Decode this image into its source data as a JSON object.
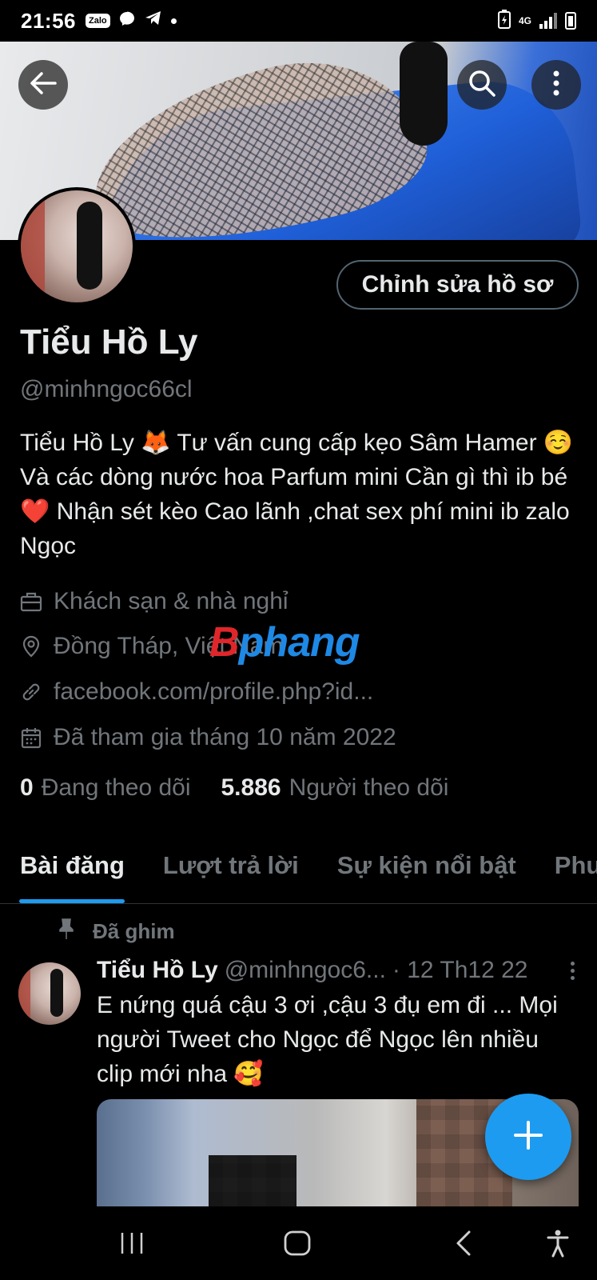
{
  "status_bar": {
    "time": "21:56",
    "zalo_badge": "Zalo",
    "network": "4G",
    "icons": [
      "zalo-icon",
      "messenger-icon",
      "telegram-icon",
      "notification-dot",
      "battery-saver-icon",
      "network-4g-icon",
      "signal-icon",
      "battery-icon"
    ]
  },
  "header": {
    "back_icon": "arrow-left-icon",
    "search_icon": "search-icon",
    "more_icon": "more-vertical-icon"
  },
  "profile": {
    "edit_button_label": "Chỉnh sửa hồ sơ",
    "display_name": "Tiểu Hồ Ly",
    "handle": "@minhngoc66cl",
    "bio": "Tiểu Hồ Ly 🦊 Tư vấn cung cấp kẹo Sâm Hamer ☺️  Và các dòng nước hoa Parfum mini Cần gì thì ib bé ❤️ Nhận sét kèo Cao lãnh ,chat sex phí mini ib zalo Ngọc",
    "category": "Khách sạn & nhà nghỉ",
    "location": "Đồng Tháp, Việt Nam",
    "website": "facebook.com/profile.php?id...",
    "joined": "Đã tham gia tháng 10 năm 2022",
    "following_count": "0",
    "following_label": "Đang theo dõi",
    "followers_count": "5.886",
    "followers_label": "Người theo dõi"
  },
  "watermark": {
    "part_a": "B",
    "part_b": "phang"
  },
  "tabs": [
    {
      "label": "Bài đăng",
      "active": true
    },
    {
      "label": "Lượt trả lời",
      "active": false
    },
    {
      "label": "Sự kiện nổi bật",
      "active": false
    },
    {
      "label": "Phư",
      "active": false
    }
  ],
  "pinned_tweet": {
    "pinned_label": "Đã ghim",
    "author_name": "Tiểu Hồ Ly",
    "author_handle": "@minhngoc6...",
    "time": "· 12 Th12 22",
    "text": "E nứng quá cậu 3 ơi ,cậu 3 đụ em đi ... Mọi người Tweet cho Ngọc để Ngọc lên nhiều clip mới nha 🥰"
  },
  "fab": {
    "icon": "plus-icon"
  },
  "nav_bar": {
    "icons": [
      "recent-apps-icon",
      "home-icon",
      "back-icon",
      "accessibility-icon"
    ]
  },
  "colors": {
    "accent": "#1d9bf0",
    "text_primary": "#e7e9ea",
    "text_secondary": "#71767b",
    "background": "#000000",
    "border": "#2f3336"
  }
}
